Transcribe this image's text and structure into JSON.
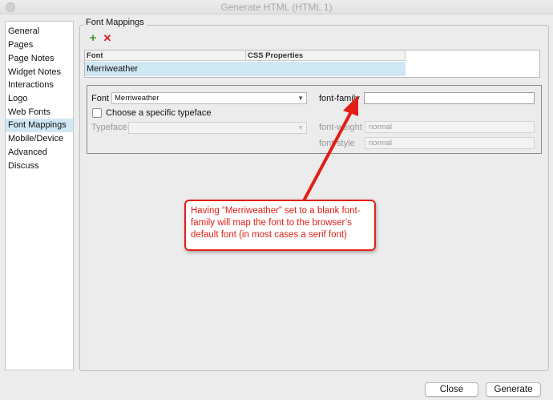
{
  "window": {
    "title": "Generate HTML (HTML 1)"
  },
  "sidebar": {
    "items": [
      {
        "label": "General"
      },
      {
        "label": "Pages"
      },
      {
        "label": "Page Notes"
      },
      {
        "label": "Widget Notes"
      },
      {
        "label": "Interactions"
      },
      {
        "label": "Logo"
      },
      {
        "label": "Web Fonts"
      },
      {
        "label": "Font Mappings",
        "selected": true
      },
      {
        "label": "Mobile/Device"
      },
      {
        "label": "Advanced"
      },
      {
        "label": "Discuss"
      }
    ]
  },
  "panel": {
    "title": "Font Mappings",
    "add_icon": "plus-icon",
    "delete_icon": "x-icon",
    "table": {
      "columns": [
        "Font",
        "CSS Properties"
      ],
      "rows": [
        {
          "font": "Merriweather",
          "css": ""
        }
      ]
    },
    "editor": {
      "font_label": "Font",
      "font_value": "Merriweather",
      "specific_typeface_label": "Choose a specific typeface",
      "specific_typeface_checked": false,
      "typeface_label": "Typeface",
      "typeface_value": "",
      "font_family_label": "font-family",
      "font_family_value": "",
      "font_weight_label": "font-weight",
      "font_weight_value": "normal",
      "font_style_label": "font-style",
      "font_style_value": "normal"
    }
  },
  "annotation": {
    "text": "Having “Merriweather” set to a blank font-family will map the font to the browser’s default font (in most cases a serif font)",
    "color": "#e22018"
  },
  "buttons": {
    "close": "Close",
    "generate": "Generate"
  }
}
